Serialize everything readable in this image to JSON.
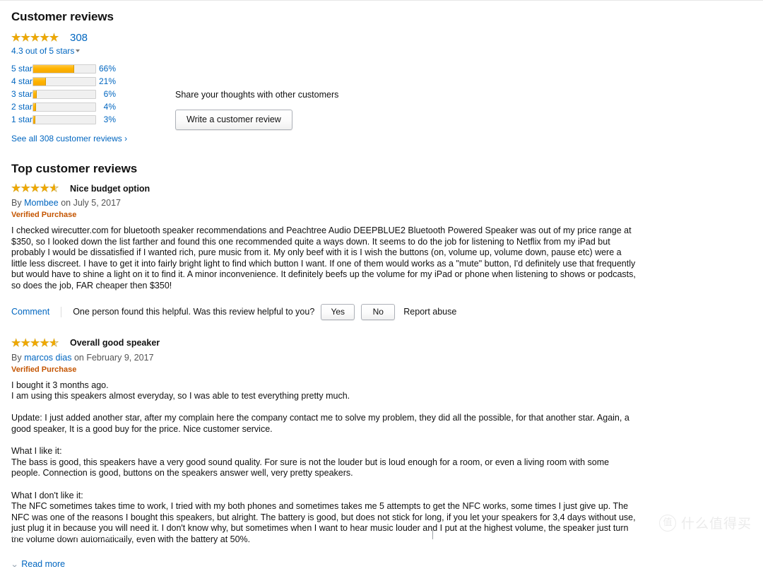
{
  "section": {
    "title": "Customer reviews"
  },
  "summary": {
    "stars_filled": 4.5,
    "rating_count": "308",
    "average_text": "4.3 out of 5 stars",
    "histogram": [
      {
        "label": "5 star",
        "percent": "66%",
        "value": 66
      },
      {
        "label": "4 star",
        "percent": "21%",
        "value": 21
      },
      {
        "label": "3 star",
        "percent": "6%",
        "value": 6
      },
      {
        "label": "2 star",
        "percent": "4%",
        "value": 4
      },
      {
        "label": "1 star",
        "percent": "3%",
        "value": 3
      }
    ],
    "see_all_link": "See all 308 customer reviews ›"
  },
  "share": {
    "prompt": "Share your thoughts with other customers",
    "button_label": "Write a customer review"
  },
  "top_reviews_header": "Top customer reviews",
  "reviews": [
    {
      "stars": 4,
      "title": "Nice budget option",
      "by_prefix": "By",
      "author": "Mombee",
      "on_text": "on July 5, 2017",
      "verified": "Verified Purchase",
      "paragraphs": [
        "I checked wirecutter.com for bluetooth speaker recommendations and Peachtree Audio DEEPBLUE2 Bluetooth Powered Speaker was out of my price range at $350, so I looked down the list farther and found this one recommended quite a ways down. It seems to do the job for listening to Netflix from my iPad but probably I would be dissatisfied if I wanted rich, pure music from it. My only beef with it is I wish the buttons (on, volume up, volume down, pause etc) were a little less discreet. I have to get it into fairly bright light to find which button I want. If one of them would works as a \"mute\" button, I'd definitely use that frequently but would have to shine a light on it to find it. A minor inconvenience. It definitely beefs up the volume for my iPad or phone when listening to shows or podcasts, so does the job, FAR cheaper then $350!"
      ],
      "footer": {
        "comment_label": "Comment",
        "helpful_text": "One person found this helpful. Was this review helpful to you?",
        "yes_label": "Yes",
        "no_label": "No",
        "report_label": "Report abuse"
      }
    },
    {
      "stars": 4,
      "title": "Overall good speaker",
      "by_prefix": "By",
      "author": "marcos dias",
      "on_text": "on February 9, 2017",
      "verified": "Verified Purchase",
      "paragraphs": [
        "I bought it 3 months ago.",
        "I am using this speakers almost everyday, so I was able to test everything pretty much.",
        "",
        "Update: I just added another star, after my complain here the company contact me to solve my problem, they did all the possible, for that another star. Again, a good speaker, It is a good buy for the price. Nice customer service.",
        "",
        "What I like it:",
        "The bass is good, this speakers have a very good sound quality. For sure is not the louder but is loud enough for a room, or even a living room with some people. Connection is good, buttons on the speakers answer well, very pretty speakers.",
        "",
        "What I don't like it:",
        "The NFC sometimes takes time to work, I tried with my both phones and sometimes takes me 5 attempts to get the NFC works, some times I just give up. The NFC was one of the reasons I bought this speakers, but alright. The battery is good, but does not stick for long, if you let your speakers for 3,4 days without use, just plug it in because you will need it. I don't know why, but sometimes when I want to hear music louder and I put at the highest volume, the speaker just turn the volume down automatically, even with the battery at 50%."
      ],
      "read_more_label": "Read more"
    }
  ],
  "watermark": {
    "badge": "值",
    "text": "什么值得买"
  },
  "colors": {
    "link": "#0066c0",
    "star": "#f0a800",
    "verified": "#c45500",
    "bar_fill": "#ffb400"
  }
}
